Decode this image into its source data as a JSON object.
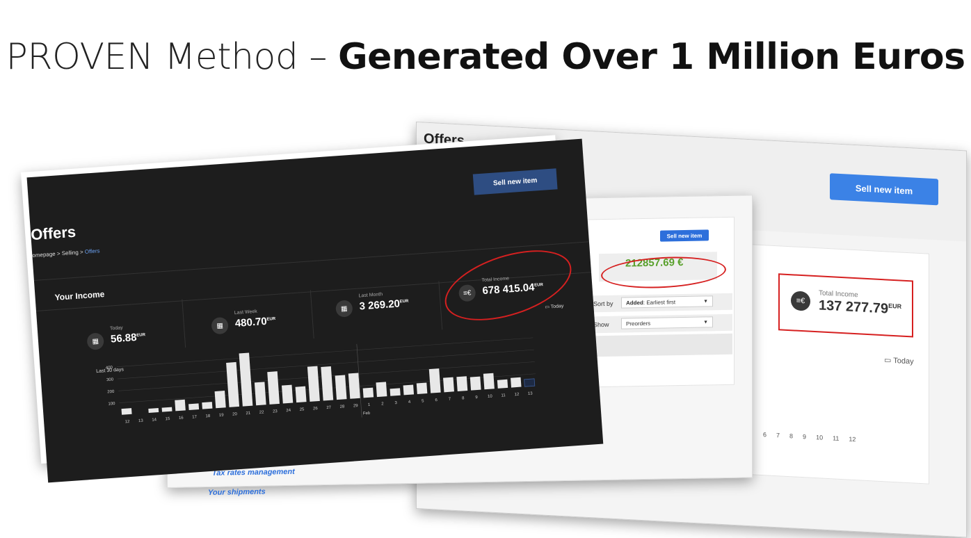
{
  "slide": {
    "title_light": "PROVEN Method – ",
    "title_bold": "Generated Over 1 Million Euros"
  },
  "right": {
    "title": "Offers",
    "sell_button": "Sell new item",
    "income_label": "Total Income",
    "income_value": "137 277.79",
    "income_unit": "EUR",
    "today": "Today",
    "ticks": [
      "6",
      "7",
      "8",
      "9",
      "10",
      "11",
      "12"
    ]
  },
  "middle": {
    "sell_button": "Sell new item",
    "amount": "212857.69 €",
    "sort_label": "Sort by",
    "sort_value_bold": "Added",
    "sort_value": ": Earliest first",
    "show_label": "Show",
    "show_value": "Preorders",
    "link1": "Tax rates management",
    "link2": "Your shipments"
  },
  "left": {
    "sell_button": "Sell new item",
    "title": "Offers",
    "breadcrumb": [
      "omepage",
      "Selling",
      "Offers"
    ],
    "your_income": "Your Income",
    "stats": [
      {
        "label": "Today",
        "value": "56.88",
        "unit": "EUR"
      },
      {
        "label": "Last Week",
        "value": "480.70",
        "unit": "EUR"
      },
      {
        "label": "Last Month",
        "value": "3 269.20",
        "unit": "EUR"
      },
      {
        "label": "Total Income",
        "value": "678 415.04",
        "unit": "EUR"
      }
    ],
    "today": "Today",
    "chart_title": "Last 30 days"
  },
  "chart_data": {
    "type": "bar",
    "title": "Last 30 days",
    "categories": [
      "12",
      "13",
      "14",
      "15",
      "16",
      "17",
      "18",
      "19",
      "20",
      "21",
      "22",
      "23",
      "24",
      "25",
      "26",
      "27",
      "28",
      "29",
      "1",
      "2",
      "3",
      "4",
      "5",
      "6",
      "7",
      "8",
      "9",
      "10",
      "11",
      "12",
      "13"
    ],
    "values": [
      50,
      0,
      35,
      35,
      90,
      50,
      55,
      140,
      370,
      440,
      190,
      270,
      150,
      130,
      290,
      280,
      200,
      210,
      80,
      120,
      60,
      80,
      90,
      200,
      120,
      120,
      110,
      130,
      70,
      80,
      60
    ],
    "month_label": "Feb",
    "y_ticks": [
      100,
      200,
      300,
      400
    ],
    "ylim": [
      0,
      450
    ]
  }
}
